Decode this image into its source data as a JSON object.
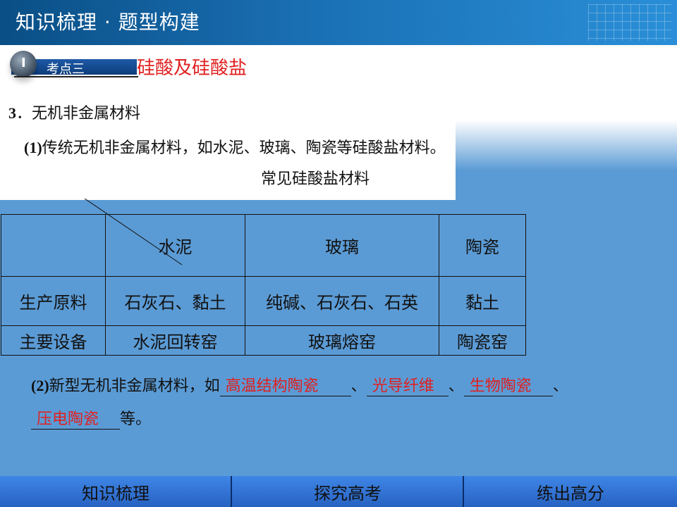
{
  "header": {
    "title": "知识梳理 · 题型构建"
  },
  "badge": {
    "roman": "I",
    "label": "考点三"
  },
  "section_title": "硅酸及硅酸盐",
  "item3": {
    "num": "3",
    "sep": "．",
    "text": "无机非金属材料"
  },
  "item3_1": {
    "num": "(1)",
    "text": "传统无机非金属材料，如水泥、玻璃、陶瓷等硅酸盐材料。"
  },
  "table": {
    "caption": "常见硅酸盐材料",
    "headers": [
      "水泥",
      "玻璃",
      "陶瓷"
    ],
    "rows": [
      {
        "label": "生产原料",
        "cells": [
          "石灰石、黏土",
          "纯碱、石灰石、石英",
          "黏土"
        ]
      },
      {
        "label": "主要设备",
        "cells": [
          "水泥回转窑",
          "玻璃熔窑",
          "陶瓷窑"
        ]
      }
    ]
  },
  "item3_2": {
    "num": "(2)",
    "prefix": "新型无机非金属材料，如",
    "answers": [
      "高温结构陶瓷",
      "光导纤维",
      "生物陶瓷",
      "压电陶瓷"
    ],
    "sep": "、",
    "suffix": "等。"
  },
  "footer": {
    "tabs": [
      "知识梳理",
      "探究高考",
      "练出高分"
    ]
  }
}
